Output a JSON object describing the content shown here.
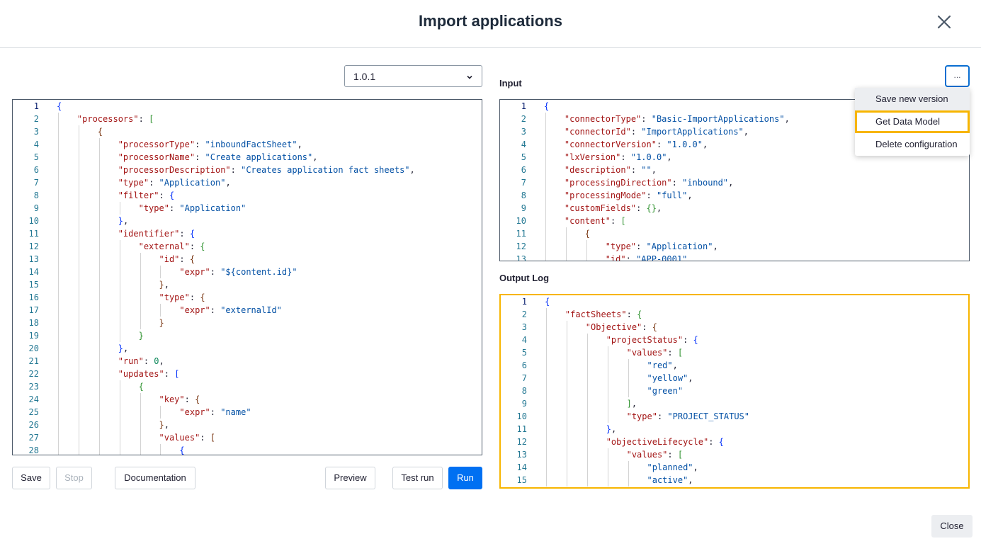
{
  "dialog": {
    "title": "Import applications",
    "close_icon": "close-icon"
  },
  "version_select": {
    "value": "1.0.1"
  },
  "left_editor": {
    "lines": [
      "{",
      "    \"processors\": [",
      "        {",
      "            \"processorType\": \"inboundFactSheet\",",
      "            \"processorName\": \"Create applications\",",
      "            \"processorDescription\": \"Creates application fact sheets\",",
      "            \"type\": \"Application\",",
      "            \"filter\": {",
      "                \"type\": \"Application\"",
      "            },",
      "            \"identifier\": {",
      "                \"external\": {",
      "                    \"id\": {",
      "                        \"expr\": \"${content.id}\"",
      "                    },",
      "                    \"type\": {",
      "                        \"expr\": \"externalId\"",
      "                    }",
      "                }",
      "            },",
      "            \"run\": 0,",
      "            \"updates\": [",
      "                {",
      "                    \"key\": {",
      "                        \"expr\": \"name\"",
      "                    },",
      "                    \"values\": [",
      "                        {"
    ]
  },
  "input": {
    "label": "Input",
    "lines": [
      "{",
      "    \"connectorType\": \"Basic-ImportApplications\",",
      "    \"connectorId\": \"ImportApplications\",",
      "    \"connectorVersion\": \"1.0.0\",",
      "    \"lxVersion\": \"1.0.0\",",
      "    \"description\": \"\",",
      "    \"processingDirection\": \"inbound\",",
      "    \"processingMode\": \"full\",",
      "    \"customFields\": {},",
      "    \"content\": [",
      "        {",
      "            \"type\": \"Application\",",
      "            \"id\": \"APP-0001\""
    ]
  },
  "output": {
    "label": "Output Log",
    "lines": [
      "{",
      "    \"factSheets\": {",
      "        \"Objective\": {",
      "            \"projectStatus\": {",
      "                \"values\": [",
      "                    \"red\",",
      "                    \"yellow\",",
      "                    \"green\"",
      "                ],",
      "                \"type\": \"PROJECT_STATUS\"",
      "            },",
      "            \"objectiveLifecycle\": {",
      "                \"values\": [",
      "                    \"planned\",",
      "                    \"active\","
    ]
  },
  "more_button": {
    "label": "..."
  },
  "menu": {
    "items": [
      "Save new version",
      "Get Data Model",
      "Delete configuration"
    ]
  },
  "buttons": {
    "save": "Save",
    "stop": "Stop",
    "documentation": "Documentation",
    "preview": "Preview",
    "test_run": "Test run",
    "run": "Run",
    "close": "Close"
  },
  "colors": {
    "primary": "#0070f2",
    "highlight": "#f7b500",
    "key": "#a31515",
    "string": "#0451a5"
  }
}
